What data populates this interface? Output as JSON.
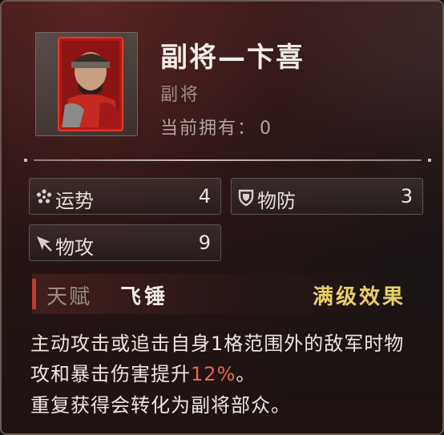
{
  "general": {
    "title": "副将—卞喜",
    "type": "副将",
    "owned_label": "当前拥有：",
    "owned_count": "0"
  },
  "stats": [
    {
      "icon": "fortune-icon",
      "label": "运势",
      "value": "4"
    },
    {
      "icon": "shield-icon",
      "label": "物防",
      "value": "3"
    },
    {
      "icon": "attack-cursor-icon",
      "label": "物攻",
      "value": "9"
    }
  ],
  "talent": {
    "label": "天赋",
    "name": "飞锤",
    "max_effect": "满级效果",
    "desc_prefix": "主动攻击或追击自身1格范围外的敌军时物攻和暴击伤害提升",
    "desc_highlight": "12%",
    "desc_suffix": "。",
    "note": "重复获得会转化为副将部众。"
  },
  "colors": {
    "highlight": "#e86a4a",
    "max_effect": "#e8cf6a",
    "talent_bar": "#c23a2a"
  }
}
